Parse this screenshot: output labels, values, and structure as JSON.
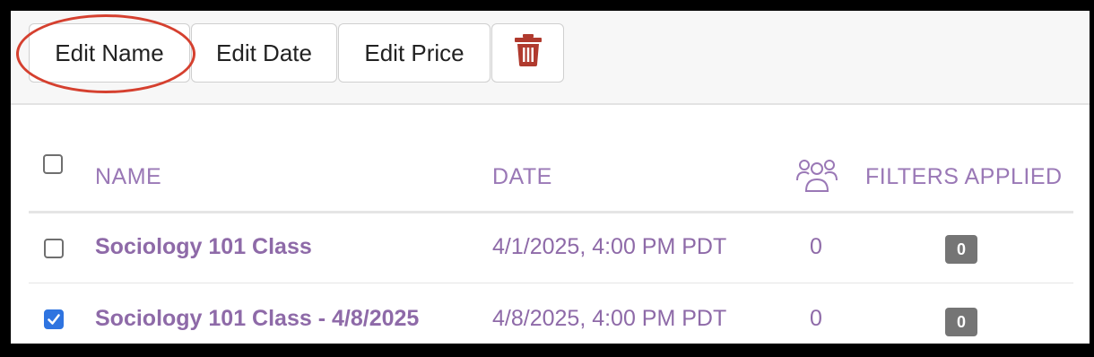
{
  "toolbar": {
    "edit_name_label": "Edit Name",
    "edit_date_label": "Edit Date",
    "edit_price_label": "Edit Price",
    "delete_icon": "trash-icon"
  },
  "table": {
    "columns": {
      "name": "NAME",
      "date": "DATE",
      "attendees_icon": "people-icon",
      "filters": "FILTERS APPLIED"
    },
    "rows": [
      {
        "checked": false,
        "name": "Sociology 101 Class",
        "date": "4/1/2025, 4:00 PM PDT",
        "attendees": "0",
        "filters": "0"
      },
      {
        "checked": true,
        "name": "Sociology 101 Class - 4/8/2025",
        "date": "4/8/2025, 4:00 PM PDT",
        "attendees": "0",
        "filters": "0"
      }
    ]
  },
  "colors": {
    "accent_purple": "#8e6aa8",
    "delete_red": "#b03a2e",
    "highlight_ring": "#d5402f",
    "checkbox_blue": "#2f74e0"
  }
}
